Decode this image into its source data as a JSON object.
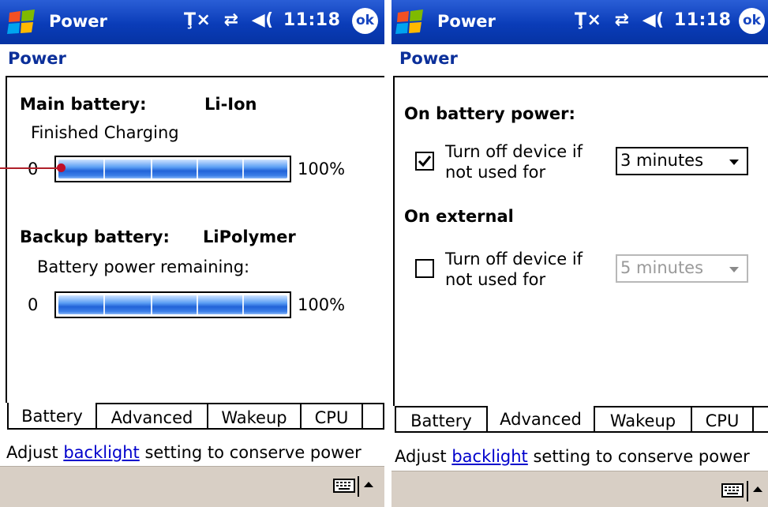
{
  "left_screen": {
    "title": "Power",
    "status_time": "11:18",
    "ok_label": "ok",
    "page_heading": "Power",
    "main_battery": {
      "label": "Main battery:",
      "type": "Li-Ion",
      "status": "Finished Charging",
      "min_label": "0",
      "max_label": "100%",
      "level_percent": 100
    },
    "backup_battery": {
      "label": "Backup battery:",
      "type": "LiPolymer",
      "status": "Battery power remaining:",
      "min_label": "0",
      "max_label": "100%",
      "level_percent": 100
    },
    "tabs": [
      {
        "label": "Battery",
        "selected": true
      },
      {
        "label": "Advanced",
        "selected": false
      },
      {
        "label": "Wakeup",
        "selected": false
      },
      {
        "label": "CPU",
        "selected": false
      }
    ],
    "hint": {
      "prefix": "Adjust ",
      "link": "backlight",
      "suffix": " setting to conserve power"
    }
  },
  "right_screen": {
    "title": "Power",
    "status_time": "11:18",
    "ok_label": "ok",
    "page_heading": "Power",
    "battery_section": {
      "heading": "On battery power:",
      "checkbox_checked": true,
      "option_line1": "Turn off device if",
      "option_line2": "not used for",
      "selected_value": "3 minutes"
    },
    "external_section": {
      "heading": "On external",
      "checkbox_checked": false,
      "option_line1": "Turn off device if",
      "option_line2": "not used for",
      "selected_value": "5 minutes"
    },
    "tabs": [
      {
        "label": "Battery",
        "selected": false
      },
      {
        "label": "Advanced",
        "selected": true
      },
      {
        "label": "Wakeup",
        "selected": false
      },
      {
        "label": "CPU",
        "selected": false
      }
    ],
    "hint": {
      "prefix": "Adjust ",
      "link": "backlight",
      "suffix": " setting to conserve power"
    }
  },
  "colors": {
    "titlebar": "#0a3cb8",
    "heading": "#0b2f9a",
    "link": "#0000cc",
    "menubar": "#d8cfc5",
    "pointer": "#c0102a"
  }
}
